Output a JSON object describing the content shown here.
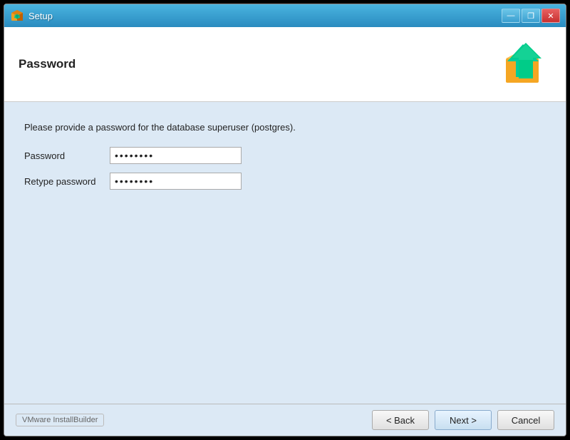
{
  "window": {
    "title": "Setup",
    "buttons": {
      "minimize": "—",
      "maximize": "❐",
      "close": "✕"
    }
  },
  "header": {
    "title": "Password"
  },
  "content": {
    "description": "Please provide a password for the database superuser (postgres).",
    "fields": [
      {
        "label": "Password",
        "value": "••••••••",
        "placeholder": ""
      },
      {
        "label": "Retype password",
        "value": "••••••••",
        "placeholder": ""
      }
    ]
  },
  "footer": {
    "brand": "VMware InstallBuilder",
    "buttons": {
      "back": "< Back",
      "next": "Next >",
      "cancel": "Cancel"
    }
  }
}
